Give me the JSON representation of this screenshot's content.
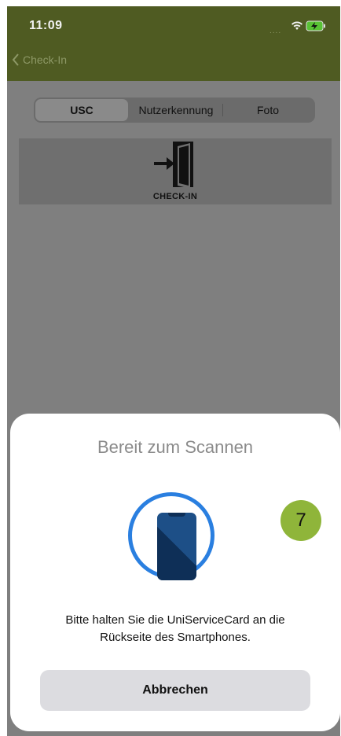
{
  "status_bar": {
    "time": "11:09",
    "signal": "....",
    "wifi_icon": "wifi-icon",
    "battery_icon": "battery-charging-icon"
  },
  "nav": {
    "back_label": "Check-In",
    "back_icon": "chevron-left-icon"
  },
  "segmented": {
    "items": [
      {
        "label": "USC",
        "selected": true
      },
      {
        "label": "Nutzerkennung",
        "selected": false
      },
      {
        "label": "Foto",
        "selected": false
      }
    ]
  },
  "banner": {
    "icon": "door-enter-icon",
    "text": "CHECK-IN"
  },
  "sheet": {
    "title": "Bereit zum Scannen",
    "icon": "phone-scan-icon",
    "badge": "7",
    "instruction_line1": "Bitte halten Sie die UniServiceCard an die",
    "instruction_line2": "Rückseite des Smartphones.",
    "cancel_label": "Abbrechen"
  },
  "colors": {
    "topbar": "#4f5b22",
    "ring": "#2a7fe0",
    "badge": "#8fb53a"
  }
}
